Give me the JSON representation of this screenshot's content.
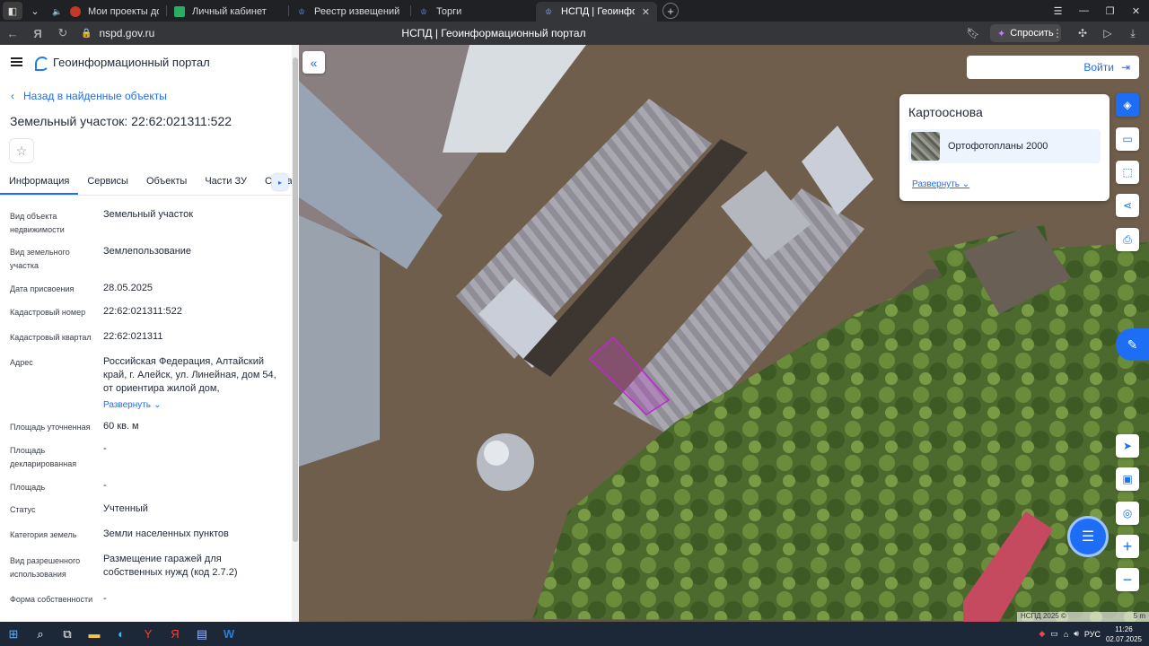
{
  "browser": {
    "tabs": [
      {
        "title": "Мои проекты документо",
        "active": false
      },
      {
        "title": "Личный кабинет",
        "active": false
      },
      {
        "title": "Реестр извещений",
        "active": false
      },
      {
        "title": "Торги",
        "active": false
      },
      {
        "title": "НСПД | Геоинформаци",
        "active": true
      }
    ],
    "url": "nspd.gov.ru",
    "page_title": "НСПД | Геоинформационный портал",
    "ask_label": "Спросить"
  },
  "header": {
    "title": "Геоинформационный портал"
  },
  "back_label": "Назад в найденные объекты",
  "object_title": "Земельный участок: 22:62:021311:522",
  "tabs": [
    "Информация",
    "Сервисы",
    "Объекты",
    "Части ЗУ",
    "Соста"
  ],
  "attributes": [
    {
      "key": "Вид объекта недвижимости",
      "value": "Земельный участок"
    },
    {
      "key": "Вид земельного участка",
      "value": "Землепользование"
    },
    {
      "key": "Дата присвоения",
      "value": "28.05.2025"
    },
    {
      "key": "Кадастровый номер",
      "value": "22:62:021311:522"
    },
    {
      "key": "Кадастровый квартал",
      "value": "22:62:021311"
    },
    {
      "key": "Адрес",
      "value": "Российская Федерация, Алтайский край, г. Алейск, ул. Линейная, дом 54, от ориентира жилой дом,",
      "expand": "Развернуть"
    },
    {
      "key": "Площадь уточненная",
      "value": "60 кв. м"
    },
    {
      "key": "Площадь декларированная",
      "value": "-"
    },
    {
      "key": "Площадь",
      "value": "-"
    },
    {
      "key": "Статус",
      "value": "Учтенный"
    },
    {
      "key": "Категория земель",
      "value": "Земли населенных пунктов"
    },
    {
      "key": "Вид разрешенного использования",
      "value": "Размещение гаражей для собственных нужд (код 2.7.2)"
    },
    {
      "key": "Форма собственности",
      "value": "-"
    }
  ],
  "map": {
    "login_label": "Войти",
    "basemap_title": "Картооснова",
    "basemap_item": "Ортофотопланы 2000",
    "basemap_expand": "Развернуть",
    "attribution": "НСПД 2025 ©",
    "scale": "5 m",
    "parcel_color": "#c026d3"
  },
  "taskbar": {
    "lang": "РУС",
    "time": "11:26",
    "date": "02.07.2025"
  }
}
